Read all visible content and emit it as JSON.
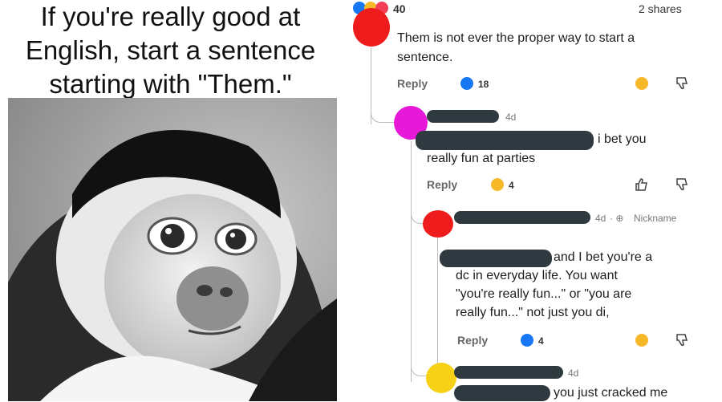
{
  "meme": {
    "title_lines": [
      "If you're really good at",
      "English, start a sentence",
      "starting with \"Them.\""
    ]
  },
  "post": {
    "reaction_count": "40",
    "shares": "2 shares"
  },
  "comments": [
    {
      "text_lines": [
        "Them is not ever the proper way to start a",
        "sentence."
      ],
      "reply_label": "Reply",
      "reaction_count": "18"
    },
    {
      "time": "4d",
      "text_lines": [
        "i bet you",
        "really fun at parties"
      ],
      "reply_label": "Reply",
      "reaction_count": "4"
    },
    {
      "time": "4d",
      "badge": "Nickname",
      "text_lines": [
        "and I bet you're a",
        "dc   in everyday life. You want",
        "\"you're really fun...\" or \"you are",
        "really fun...\" not just you di,"
      ],
      "reply_label": "Reply",
      "reaction_count": "4"
    },
    {
      "time": "4d",
      "text_lines": [
        "you just cracked me"
      ]
    }
  ],
  "colors": {
    "avatar_red": "#ee1c1c",
    "avatar_magenta": "#e619d8",
    "avatar_yellow": "#f6d116",
    "like_blue": "#1877f2",
    "redaction": "#2f3a40"
  }
}
